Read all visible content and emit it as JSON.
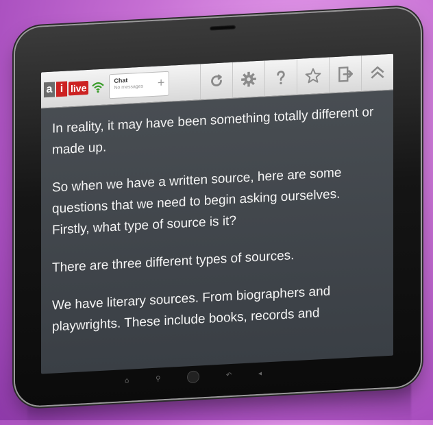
{
  "app": {
    "logo": {
      "a": "a",
      "i": "i",
      "live": "live"
    }
  },
  "toolbar": {
    "chat_title": "Chat",
    "chat_subtitle": "No messages",
    "buttons": [
      {
        "name": "refresh-icon"
      },
      {
        "name": "settings-gear-icon"
      },
      {
        "name": "help-icon"
      },
      {
        "name": "star-icon"
      },
      {
        "name": "exit-icon"
      },
      {
        "name": "collapse-chevron-icon"
      }
    ]
  },
  "transcript": {
    "paragraphs": [
      "In reality, it may have been something totally different or made up.",
      "So when we have a written source, here are some questions that we need to begin asking ourselves. Firstly, what type of source is it?",
      "There are three different types of sources.",
      "We have literary sources. From biographers and playwrights. These include books, records and"
    ]
  },
  "colors": {
    "background": "#c66fd3",
    "tablet_frame": "#151515",
    "toolbar": "#e6e6e6",
    "screen": "#42474c",
    "text": "#f4f4f4",
    "live_red": "#cc2222",
    "wifi_green": "#3a9d2a"
  }
}
